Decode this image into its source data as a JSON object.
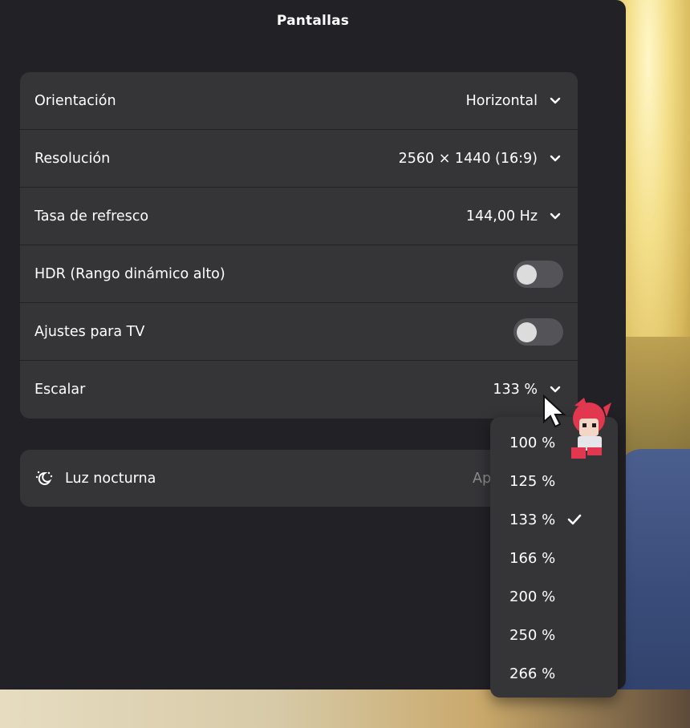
{
  "window": {
    "title": "Pantallas"
  },
  "settings": {
    "orientation": {
      "label": "Orientación",
      "value": "Horizontal"
    },
    "resolution": {
      "label": "Resolución",
      "value": "2560 × 1440 (16:9)"
    },
    "refresh_rate": {
      "label": "Tasa de refresco",
      "value": "144,00 Hz"
    },
    "hdr": {
      "label": "HDR (Rango dinámico alto)",
      "enabled": false
    },
    "tv_settings": {
      "label": "Ajustes para TV",
      "enabled": false
    },
    "scale": {
      "label": "Escalar",
      "value": "133 %"
    }
  },
  "night_light": {
    "label": "Luz nocturna",
    "value": "Ap"
  },
  "scale_menu": {
    "options": [
      "100 %",
      "125 %",
      "133 %",
      "166 %",
      "200 %",
      "250 %",
      "266 %"
    ],
    "selected": "133 %"
  },
  "icons": {
    "chevron": "chevron-down-icon",
    "check": "check-icon",
    "night": "night-light-icon"
  },
  "colors": {
    "window_bg": "#222226",
    "card_bg": "#353538",
    "toggle_off": "#545458",
    "text": "#ffffff",
    "muted": "#8d8d90"
  }
}
